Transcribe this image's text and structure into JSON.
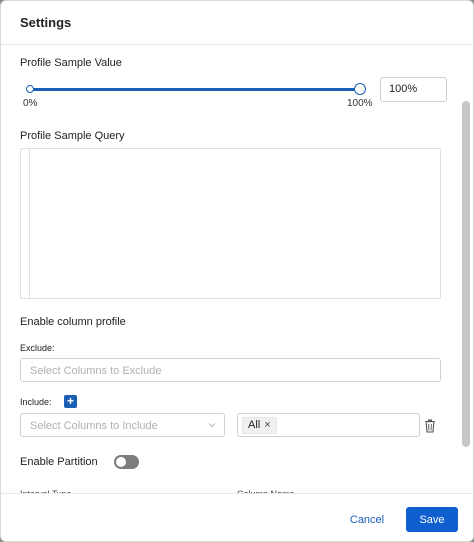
{
  "modal": {
    "title": "Settings"
  },
  "profile_sample": {
    "label": "Profile Sample Value",
    "min_mark": "0%",
    "max_mark": "100%",
    "value_text": "100%",
    "value_percent": 100
  },
  "query": {
    "label": "Profile Sample Query"
  },
  "column_profile": {
    "label": "Enable column profile",
    "exclude_label": "Exclude:",
    "exclude_placeholder": "Select Columns to Exclude",
    "include_label": "Include:",
    "include_placeholder": "Select Columns to Include",
    "include_tag": "All",
    "tag_remove": "×",
    "add_symbol": "+"
  },
  "partition": {
    "label": "Enable Partition",
    "enabled": false,
    "interval_type_label": "Interval Type",
    "column_name_label": "Column Name"
  },
  "footer": {
    "cancel_label": "Cancel",
    "save_label": "Save"
  },
  "colors": {
    "accent": "#1a5fb4",
    "primary_button": "#0f5fd1",
    "toggle_off": "#7d7d7d"
  }
}
